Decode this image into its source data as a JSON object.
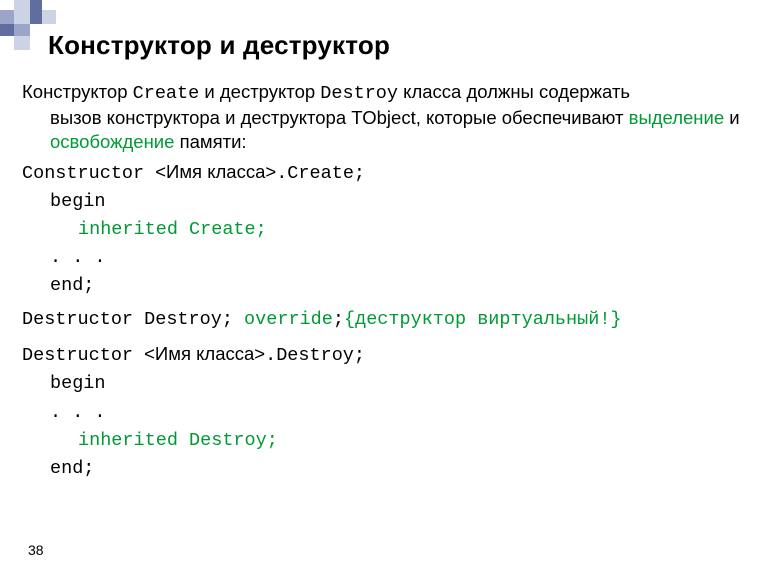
{
  "title": "Конструктор и деструктор",
  "intro": {
    "pre1": "Конструктор ",
    "mono1": "Create",
    "mid1": "  и деструктор ",
    "mono2": "Destroy",
    "post1": " класса должны содержать",
    "line2a": "вызов конструктора и деструктора TObject, которые обеспечивают ",
    "hl1": "выделение",
    "line2b": " и ",
    "hl2": "освобождение",
    "line2c": " памяти:"
  },
  "ctor": {
    "decl_a": "Constructor ",
    "decl_b": "<Имя класса>",
    "decl_c": ".Create;",
    "begin": "begin",
    "inh": "inherited Create;",
    "dots": ".  .  .",
    "end": "end;"
  },
  "dtor_proto": {
    "a": "Destructor Destroy; ",
    "ovr": "override",
    "b": ";",
    "comment": "{деструктор виртуальный!}"
  },
  "dtor": {
    "decl_a": "Destructor ",
    "decl_b": "<Имя класса>",
    "decl_c": ".Destroy;",
    "begin": "begin",
    "dots": ".  .  .",
    "inh": "inherited Destroy;",
    "end": "end;"
  },
  "pagenum": "38"
}
